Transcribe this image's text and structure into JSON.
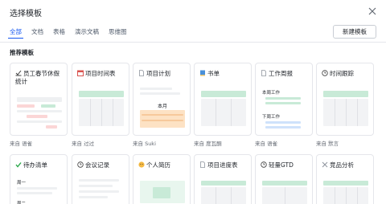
{
  "dialog": {
    "title": "选择模板"
  },
  "tabs": [
    {
      "label": "全部"
    },
    {
      "label": "文档"
    },
    {
      "label": "表格"
    },
    {
      "label": "演示文稿"
    },
    {
      "label": "思维图"
    }
  ],
  "new_template_label": "新建模板",
  "section_title": "推荐模板",
  "cards_row1": [
    {
      "title": "员工春节休假统计",
      "icon": "checklist-icon",
      "from": "来自 语雀"
    },
    {
      "title": "项目时间表",
      "icon": "calendar-icon",
      "from": "来自 过过"
    },
    {
      "title": "项目计划",
      "icon": "doc-icon",
      "from": "来自 Suki",
      "month_label": "本月"
    },
    {
      "title": "书单",
      "icon": "book-icon",
      "from": "来自 度瓦酮"
    },
    {
      "title": "工作周报",
      "icon": "doc-icon",
      "from": "来自 语雀",
      "line1": "本周工作",
      "line2": "下周工作"
    },
    {
      "title": "时间跟踪",
      "icon": "clock-icon",
      "from": "来自 默言"
    }
  ],
  "cards_row2": [
    {
      "title": "待办清单",
      "icon": "check-icon",
      "line1": "周一",
      "line2": "周二"
    },
    {
      "title": "会议记录",
      "icon": "clock-icon"
    },
    {
      "title": "个人简历",
      "icon": "person-icon"
    },
    {
      "title": "项目进度表",
      "icon": "doc-icon"
    },
    {
      "title": "轻量GTD",
      "icon": "clock-icon"
    },
    {
      "title": "竞品分析",
      "icon": "tools-icon"
    }
  ],
  "colors": {
    "accent": "#1456f0",
    "green": "#c8ead7",
    "pink": "#fbd6d6",
    "orange": "#fde2c4"
  }
}
